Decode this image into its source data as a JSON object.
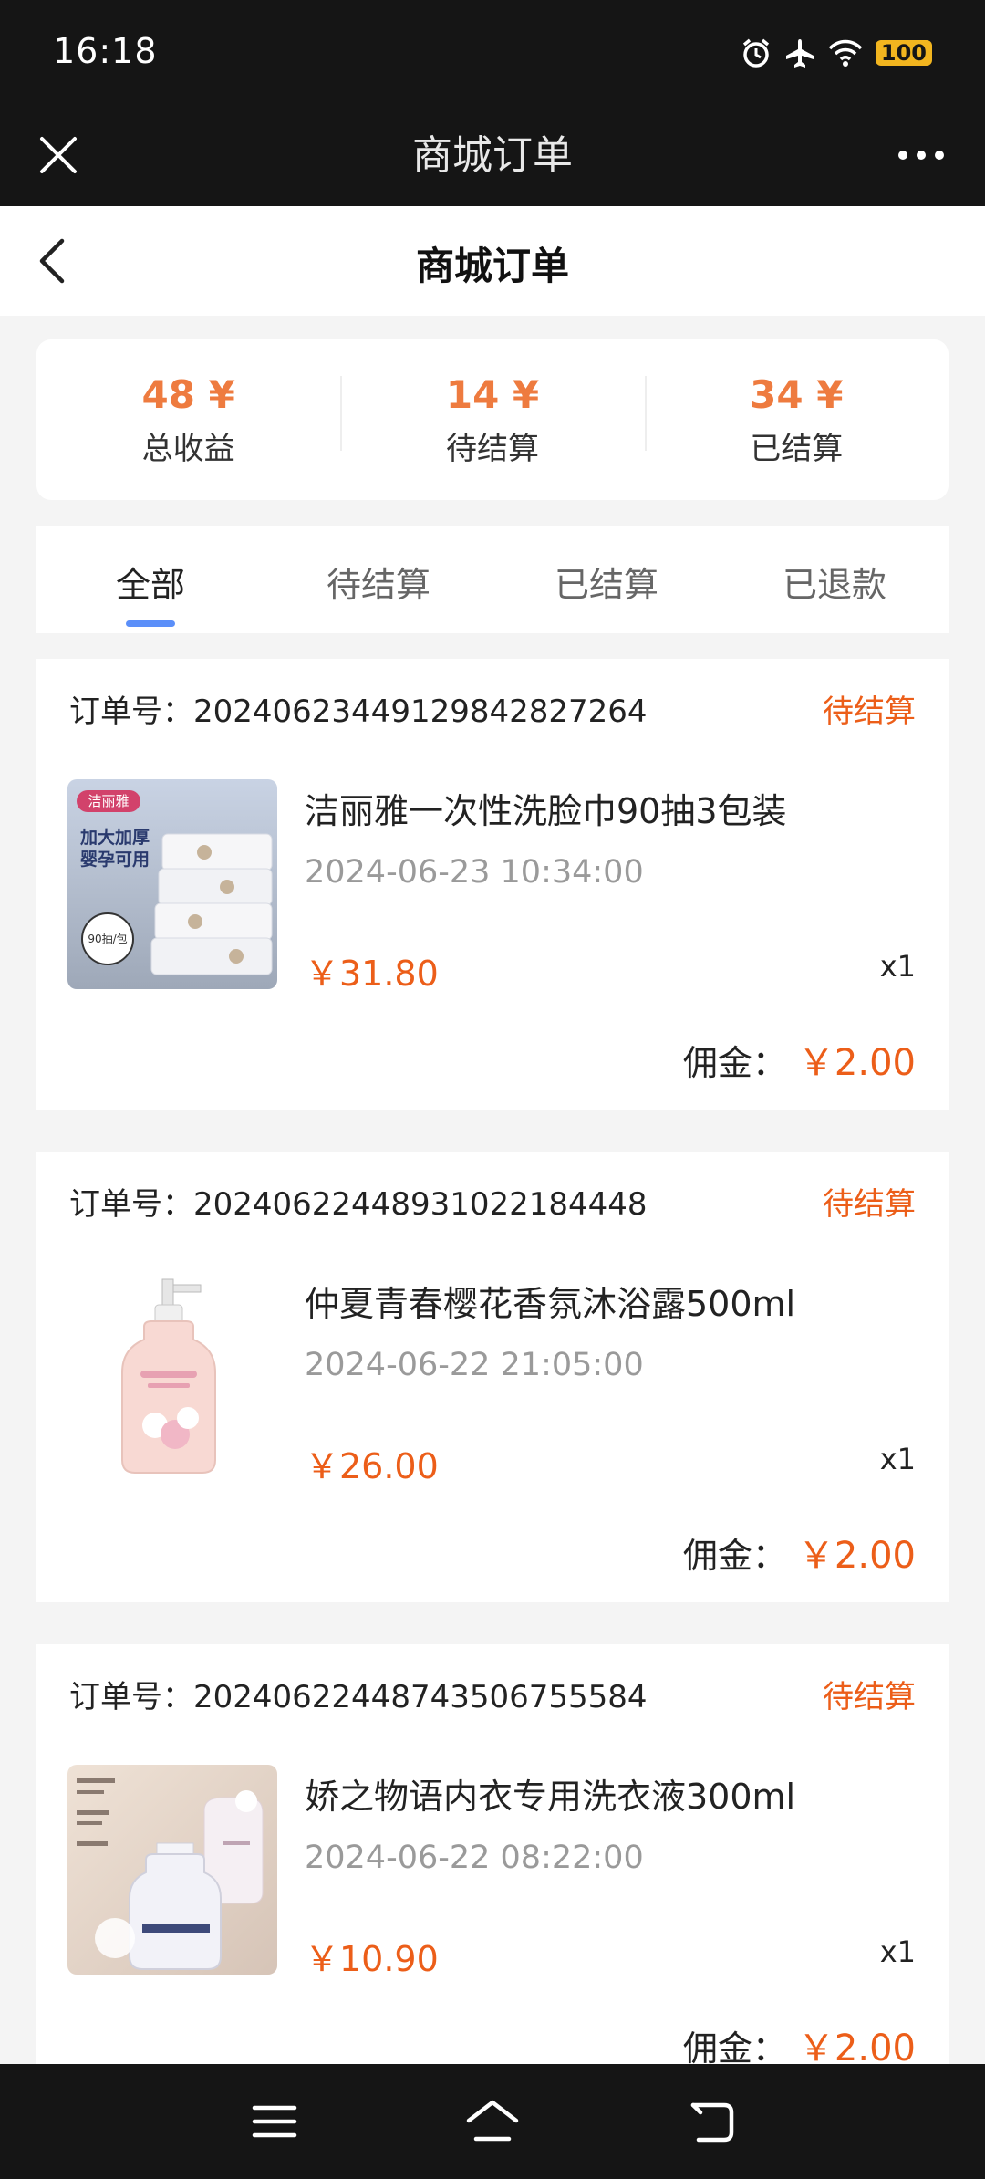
{
  "status_bar": {
    "time": "16:18",
    "battery": "100",
    "icons": [
      "alarm-icon",
      "airplane-icon",
      "wifi-icon",
      "battery-icon"
    ]
  },
  "app_bar": {
    "title": "商城订单",
    "close_icon": "close-icon",
    "more_icon": "more-icon"
  },
  "page_header": {
    "title": "商城订单",
    "back_icon": "chevron-left-icon"
  },
  "summary": {
    "stats": [
      {
        "value": "48 ¥",
        "label": "总收益"
      },
      {
        "value": "14 ¥",
        "label": "待结算"
      },
      {
        "value": "34 ¥",
        "label": "已结算"
      }
    ]
  },
  "tabs": [
    {
      "label": "全部",
      "active": true
    },
    {
      "label": "待结算",
      "active": false
    },
    {
      "label": "已结算",
      "active": false
    },
    {
      "label": "已退款",
      "active": false
    }
  ],
  "orders": [
    {
      "order_no": "订单号：20240623449129842827264",
      "status": "待结算",
      "product": "洁丽雅一次性洗脸巾90抽3包装",
      "time": "2024-06-23 10:34:00",
      "price": "￥31.80",
      "qty": "x1",
      "commission_label": "佣金：",
      "commission": "￥2.00",
      "thumb_text": {
        "brand": "洁丽雅",
        "line1": "加大加厚",
        "line2": "婴孕可用",
        "badge": "90抽/包"
      }
    },
    {
      "order_no": "订单号：20240622448931022184448",
      "status": "待结算",
      "product": "仲夏青春樱花香氛沐浴露500ml",
      "time": "2024-06-22 21:05:00",
      "price": "￥26.00",
      "qty": "x1",
      "commission_label": "佣金：",
      "commission": "￥2.00"
    },
    {
      "order_no": "订单号：20240622448743506755584",
      "status": "待结算",
      "product": "娇之物语内衣专用洗衣液300ml",
      "time": "2024-06-22 08:22:00",
      "price": "￥10.90",
      "qty": "x1",
      "commission_label": "佣金：",
      "commission": "￥2.00"
    }
  ],
  "nav_bar": {
    "icons": [
      "menu-icon",
      "home-icon",
      "back-icon"
    ]
  },
  "colors": {
    "accent": "#ec5e19",
    "stat_value": "#ee7b3f",
    "tab_indicator": "#5b8ff9",
    "dark_bar": "#151515"
  }
}
